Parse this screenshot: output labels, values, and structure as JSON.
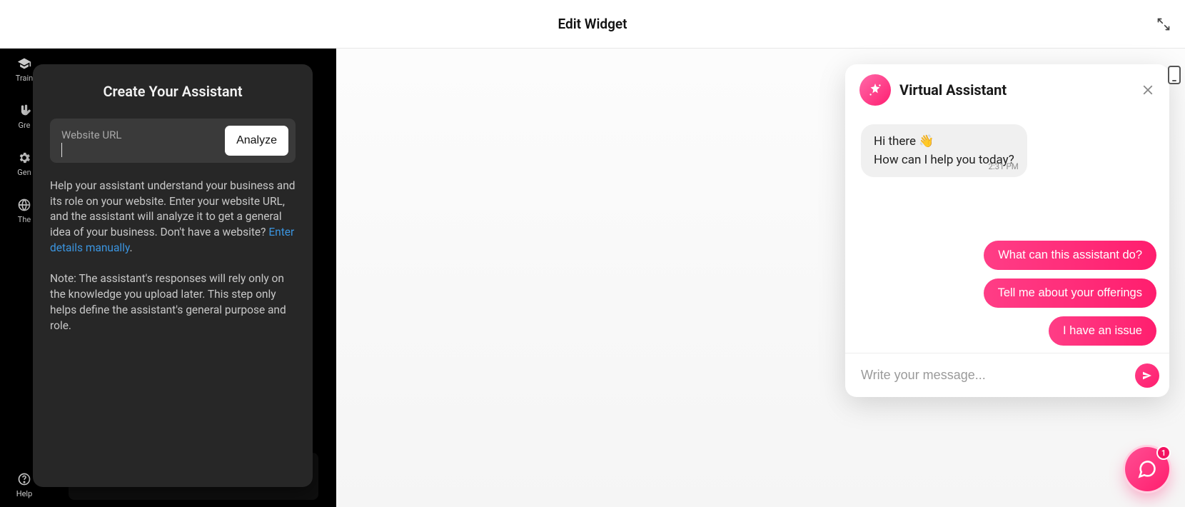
{
  "header": {
    "title": "Edit Widget"
  },
  "sidebar": {
    "items": [
      {
        "label": "Train",
        "icon": "graduation-cap-icon"
      },
      {
        "label": "Gre",
        "icon": "hand-wave-icon"
      },
      {
        "label": "Gen",
        "icon": "gear-icon"
      },
      {
        "label": "The",
        "icon": "globe-icon"
      }
    ],
    "bottom": {
      "label": "Help",
      "icon": "help-icon"
    }
  },
  "create": {
    "title": "Create Your Assistant",
    "url_label": "Website URL",
    "url_value": "",
    "analyze_label": "Analyze",
    "help_text_1": "Help your assistant understand your business and its role on your website. Enter your website URL, and the assistant will analyze it to get a general idea of your business. Don't have a website? ",
    "help_link": "Enter details manually",
    "help_text_2": ".",
    "note_text": "Note: The assistant's responses will rely only on the knowledge you upload later. This step only helps define the assistant's general purpose and role."
  },
  "chat": {
    "title": "Virtual Assistant",
    "message": {
      "line1": "Hi there ",
      "wave": "👋",
      "line2": "How can I help you today?",
      "timestamp": "2:31 PM"
    },
    "suggestions": [
      "What can this assistant do?",
      "Tell me about your offerings",
      "I have an issue"
    ],
    "input_placeholder": "Write your message..."
  },
  "fab": {
    "badge": "1"
  }
}
